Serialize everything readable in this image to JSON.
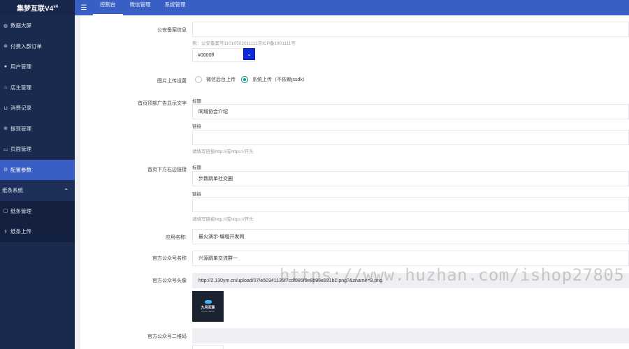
{
  "brand": {
    "name": "集梦互联V4",
    "version": "v4"
  },
  "sidebar": {
    "items": [
      {
        "label": "数据大屏",
        "icon": "dashboard-icon"
      },
      {
        "label": "付费入群订单",
        "icon": "order-icon"
      },
      {
        "label": "用户管理",
        "icon": "user-icon"
      },
      {
        "label": "店主管理",
        "icon": "shop-owner-icon"
      },
      {
        "label": "消费记录",
        "icon": "cart-icon"
      },
      {
        "label": "提现管理",
        "icon": "withdraw-icon"
      },
      {
        "label": "页面管理",
        "icon": "page-icon"
      },
      {
        "label": "配置参数",
        "icon": "gear-icon",
        "active": true
      }
    ],
    "group": {
      "label": "纸条系统"
    },
    "sub_items": [
      {
        "label": "纸条管理",
        "icon": "note-icon"
      },
      {
        "label": "纸条上传",
        "icon": "upload-icon"
      }
    ]
  },
  "topbar": {
    "menu_icon": "☰",
    "tabs": [
      {
        "label": "控制台",
        "active": true
      },
      {
        "label": "微信管理"
      },
      {
        "label": "系统管理"
      }
    ]
  },
  "form": {
    "beian": {
      "label": "公安备案信息",
      "value": "",
      "hint": "例：公安备案号11010502011111京ICP备1901111号"
    },
    "color": {
      "value": "#0000ff",
      "swatch": "#0b2bd9"
    },
    "upload": {
      "label": "图片上传设置",
      "options": [
        {
          "label": "微信后台上传",
          "checked": false
        },
        {
          "label": "系统上传（不依赖jssdk）",
          "checked": true
        }
      ]
    },
    "top_ad": {
      "label": "首页顶部广告显示文字",
      "title_label": "标题",
      "title_value": "同城协会介绍",
      "link_label": "链接",
      "link_value": "",
      "hint": "请填写链接http://或https://开头"
    },
    "bottom_link": {
      "label": "首页下方右边链接",
      "title_label": "标题",
      "title_value": "步数跳单社交圈",
      "link_label": "链接",
      "link_value": "",
      "hint": "请填写链接http://或https://开头"
    },
    "app_name": {
      "label": "应用名称:",
      "value": "最火演示-编程开发网"
    },
    "mp_name": {
      "label": "官方公众号名称",
      "value": "兴源跳单交流群一"
    },
    "mp_avatar": {
      "label": "官方公众号头像",
      "value": "http://2.130ym.cn/upload/07/e50341135f7cdf085f6e8b98e231b1.png?&zname=3.png",
      "logo_text": "九月互联",
      "logo_sub": "JiuYue HuLian"
    },
    "mp_qrcode": {
      "label": "官方公众号二维码",
      "value": ""
    }
  },
  "watermark": "https://www.huzhan.com/ishop27805"
}
